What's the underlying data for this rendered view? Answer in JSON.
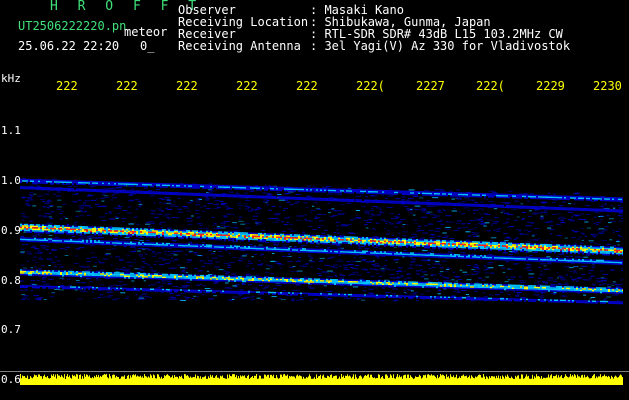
{
  "header": {
    "app_title": "H R O F F T",
    "filename": "UT2506222220.pn",
    "type_label": "meteor",
    "datetime": "25.06.22 22:20",
    "extra": "0_"
  },
  "info": [
    {
      "label": "Observer",
      "value": ": Masaki Kano"
    },
    {
      "label": "Receiving Location",
      "value": ": Shibukawa, Gunma, Japan"
    },
    {
      "label": "Receiver",
      "value": ": RTL-SDR SDR# 43dB L15 103.2MHz CW"
    },
    {
      "label": "Receiving Antenna",
      "value": ": 3el Yagi(V) Az 330 for Vladivostok"
    }
  ],
  "chart_data": {
    "type": "heatmap",
    "ylabel": "kHz",
    "y_ticks": [
      "1.1",
      "1.0",
      "0.9",
      "0.8",
      "0.7",
      "0.6"
    ],
    "y_values": [
      1.1,
      1.0,
      0.9,
      0.8,
      0.7,
      0.6
    ],
    "ylim": [
      0.6,
      1.2
    ],
    "x_ticks": [
      "222",
      "222",
      "222",
      "222",
      "222",
      "222(",
      "2227",
      "222(",
      "2229",
      "2230"
    ],
    "bands": [
      {
        "name": "",
        "start_khz": 1.025,
        "end_khz": 0.985,
        "width_khz": 0.012,
        "intensity": 0.45
      },
      {
        "name": "",
        "start_khz": 1.01,
        "end_khz": 0.96,
        "width_khz": 0.01,
        "intensity": 0.35
      },
      {
        "name": "",
        "start_khz": 0.925,
        "end_khz": 0.875,
        "width_khz": 0.02,
        "intensity": 1.0
      },
      {
        "name": "",
        "start_khz": 0.9,
        "end_khz": 0.85,
        "width_khz": 0.012,
        "intensity": 0.55
      },
      {
        "name": "",
        "start_khz": 0.83,
        "end_khz": 0.79,
        "width_khz": 0.015,
        "intensity": 0.8
      },
      {
        "name": "",
        "start_khz": 0.8,
        "end_khz": 0.765,
        "width_khz": 0.008,
        "intensity": 0.4
      }
    ],
    "noise_top_khz": [
      1.03,
      0.995
    ],
    "noise_bottom_khz": [
      0.77,
      0.765
    ],
    "colors": {
      "background": "#000000",
      "noise": "#0000c8",
      "mid": "#00c0ff",
      "high": "#ffff00",
      "peak": "#ff2020",
      "power": "#ffff00"
    }
  }
}
